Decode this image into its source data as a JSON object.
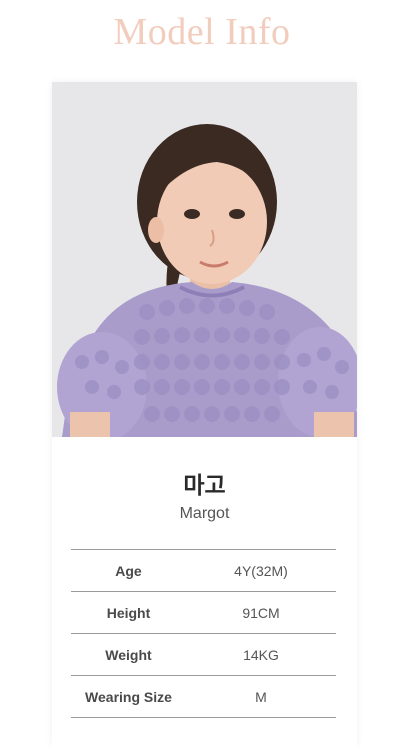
{
  "header": {
    "title": "Model Info"
  },
  "model": {
    "name_korean": "마고",
    "name_english": "Margot"
  },
  "specs": [
    {
      "label": "Age",
      "value": "4Y(32M)"
    },
    {
      "label": "Height",
      "value": "91CM"
    },
    {
      "label": "Weight",
      "value": "14KG"
    },
    {
      "label": "Wearing Size",
      "value": "M"
    }
  ],
  "colors": {
    "title": "#f2cdbd",
    "photo_background": "#e8e8ea",
    "garment": "#a99ccb",
    "divider": "#9a9a9a"
  }
}
